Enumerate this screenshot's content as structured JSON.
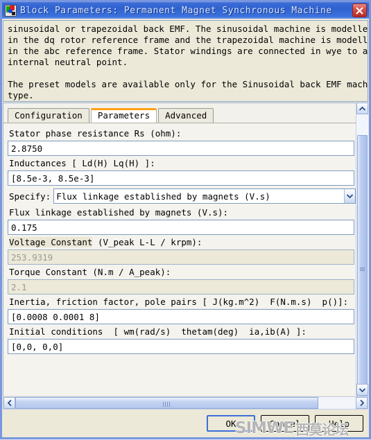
{
  "window": {
    "title": "Block Parameters: Permanent Magnet Synchronous Machine",
    "icon": "simulink-block-icon",
    "close_label": "×"
  },
  "description": {
    "text": "sinusoidal or trapezoidal back EMF. The sinusoidal machine is modelled\nin the dq rotor reference frame and the trapezoidal machine is modelled\nin the abc reference frame. Stator windings are connected in wye to an\ninternal neutral point.\n\nThe preset models are available only for the Sinusoidal back EMF machine\ntype."
  },
  "tabs": [
    {
      "label": "Configuration",
      "active": false
    },
    {
      "label": "Parameters",
      "active": true
    },
    {
      "label": "Advanced",
      "active": false
    }
  ],
  "fields": {
    "stator_resistance": {
      "label": "Stator phase resistance Rs (ohm):",
      "value": "2.8750",
      "disabled": false
    },
    "inductances": {
      "label": "Inductances [ Ld(H) Lq(H) ]:",
      "value": "[8.5e-3, 8.5e-3]",
      "disabled": false
    },
    "specify": {
      "label": "Specify:",
      "value": "Flux linkage established by magnets (V.s)",
      "options": [
        "Flux linkage established by magnets (V.s)",
        "Voltage Constant (V_peak L-L / krpm)",
        "Torque Constant (N.m / A_peak)"
      ]
    },
    "flux_linkage": {
      "label": "Flux linkage established by magnets (V.s):",
      "value": "0.175",
      "disabled": false
    },
    "voltage_constant": {
      "label_highlighted": "Voltage Constant",
      "label_rest": " (V_peak L-L / krpm):",
      "value": "253.9319",
      "disabled": true
    },
    "torque_constant": {
      "label": "Torque Constant (N.m / A_peak):",
      "value": "2.1",
      "disabled": true
    },
    "inertia": {
      "label": "Inertia, friction factor, pole pairs [ J(kg.m^2)  F(N.m.s)  p()]:",
      "value": "[0.0008 0.0001 8]",
      "disabled": false
    },
    "initial_conditions": {
      "label": "Initial conditions  [ wm(rad/s)  thetam(deg)  ia,ib(A) ]:",
      "value": "[0,0,  0,0]",
      "disabled": false
    }
  },
  "buttons": {
    "ok": "OK",
    "cancel": "Cancel",
    "help": "Help"
  },
  "watermark": {
    "latin": "SIMWE",
    "cjk": "西莫论坛"
  },
  "colors": {
    "titlebar": "#3a6ad4",
    "active_tab_accent": "#ffa015",
    "dialog_bg": "#ece9d8",
    "field_bg": "#ffffff",
    "disabled_field_bg": "#ece9d8",
    "border": "#7f9cbf"
  }
}
